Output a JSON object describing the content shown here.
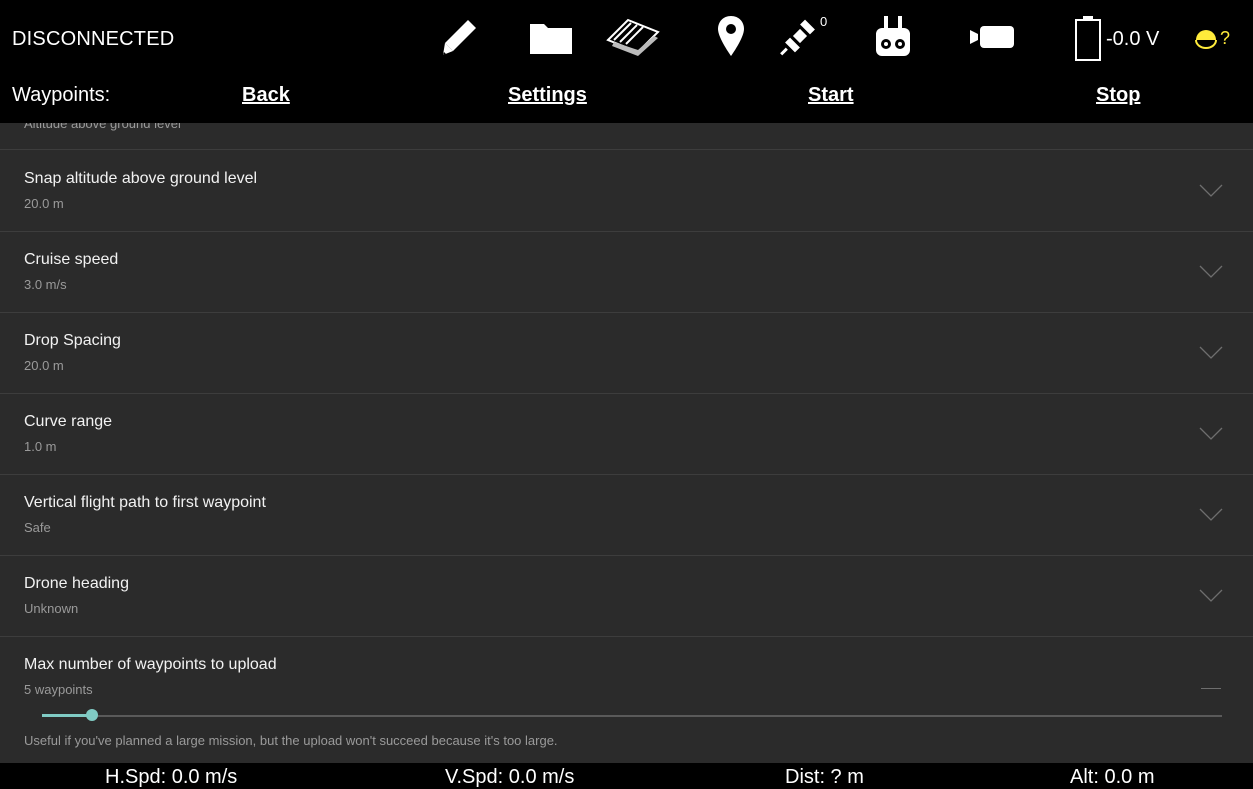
{
  "topbar": {
    "status": "DISCONNECTED",
    "icons": [
      "pencil-icon",
      "folder-icon",
      "map-layers-icon",
      "location-pin-icon",
      "satellite-icon",
      "remote-controller-icon",
      "camera-icon",
      "battery-icon",
      "gps-signal-indicator"
    ],
    "gps_count": "0",
    "voltage": "-0.0 V",
    "signal_status": "?"
  },
  "menu": {
    "label": "Waypoints:",
    "back": "Back",
    "settings": "Settings",
    "start": "Start",
    "stop": "Stop"
  },
  "settings": {
    "cut_off_text": "Altitude above ground level",
    "items": [
      {
        "title": "Snap altitude above ground level",
        "value": "20.0 m"
      },
      {
        "title": "Cruise speed",
        "value": "3.0 m/s"
      },
      {
        "title": "Drop Spacing",
        "value": "20.0 m"
      },
      {
        "title": "Curve range",
        "value": "1.0 m"
      },
      {
        "title": "Vertical flight path to first waypoint",
        "value": "Safe"
      },
      {
        "title": "Drone heading",
        "value": "Unknown"
      },
      {
        "title": "Max number of waypoints to upload",
        "value": "5 waypoints"
      }
    ],
    "slider": {
      "fraction": 0.042,
      "help_text": "Useful if you've planned a large mission, but the upload won't succeed because it's too large."
    }
  },
  "telemetry": {
    "h_spd": "H.Spd: 0.0 m/s",
    "v_spd": "V.Spd: 0.0 m/s",
    "dist": "Dist: ? m",
    "alt": "Alt: 0.0 m"
  },
  "colors": {
    "accent": "#80cbc4",
    "background": "#2b2b2b",
    "status_dot": "#ffeb3b"
  }
}
